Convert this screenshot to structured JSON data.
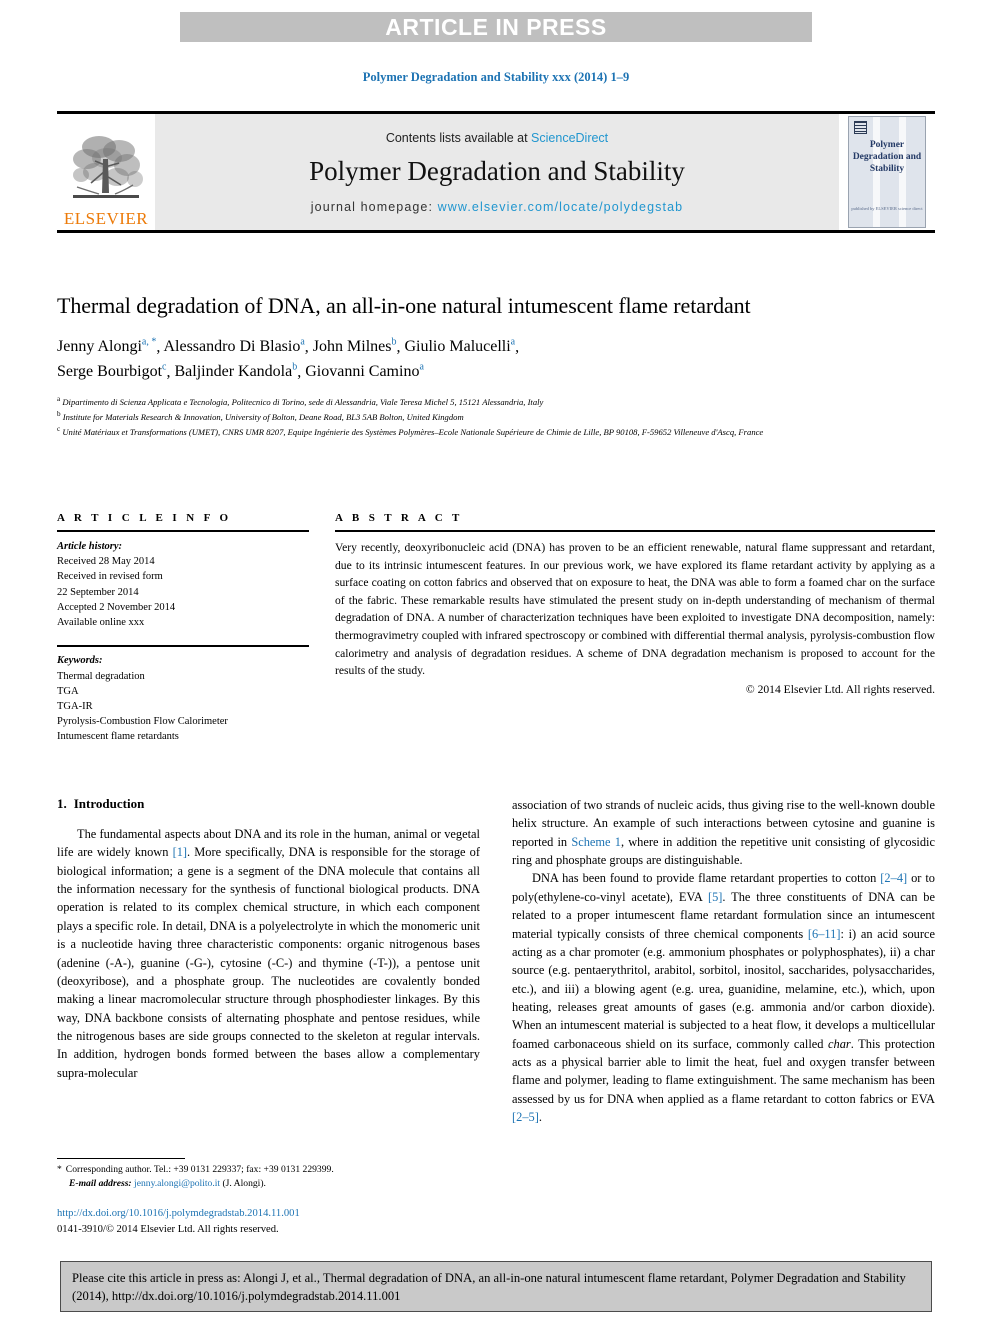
{
  "banner": {
    "text": "ARTICLE IN PRESS"
  },
  "running_head": "Polymer Degradation and Stability xxx (2014) 1–9",
  "masthead": {
    "publisher": "ELSEVIER",
    "contents_prefix": "Contents lists available at ",
    "contents_link": "ScienceDirect",
    "journal": "Polymer Degradation and Stability",
    "homepage_prefix": "journal homepage: ",
    "homepage_link": "www.elsevier.com/locate/polydegstab",
    "cover_title": "Polymer Degradation and Stability",
    "cover_footer": "published by\nELSEVIER\nscience direct"
  },
  "article": {
    "title": "Thermal degradation of DNA, an all-in-one natural intumescent flame retardant",
    "authors_line1": "Jenny Alongi",
    "authors": [
      {
        "name": "Jenny Alongi",
        "sup": "a, *"
      },
      {
        "name": "Alessandro Di Blasio",
        "sup": "a"
      },
      {
        "name": "John Milnes",
        "sup": "b"
      },
      {
        "name": "Giulio Malucelli",
        "sup": "a"
      },
      {
        "name": "Serge Bourbigot",
        "sup": "c"
      },
      {
        "name": "Baljinder Kandola",
        "sup": "b"
      },
      {
        "name": "Giovanni Camino",
        "sup": "a"
      }
    ],
    "affiliations": [
      {
        "mark": "a",
        "text": "Dipartimento di Scienza Applicata e Tecnologia, Politecnico di Torino, sede di Alessandria, Viale Teresa Michel 5, 15121 Alessandria, Italy"
      },
      {
        "mark": "b",
        "text": "Institute for Materials Research & Innovation, University of Bolton, Deane Road, BL3 5AB Bolton, United Kingdom"
      },
      {
        "mark": "c",
        "text": "Unité Matériaux et Transformations (UMET), CNRS UMR 8207, Equipe Ingénierie des Systèmes Polymères–Ecole Nationale Supérieure de Chimie de Lille, BP 90108, F-59652 Villeneuve d'Ascq, France"
      }
    ]
  },
  "info": {
    "heading": "A R T I C L E   I N F O",
    "history_label": "Article history:",
    "history": [
      "Received 28 May 2014",
      "Received in revised form",
      "22 September 2014",
      "Accepted 2 November 2014",
      "Available online xxx"
    ],
    "keywords_label": "Keywords:",
    "keywords": [
      "Thermal degradation",
      "TGA",
      "TGA-IR",
      "Pyrolysis-Combustion Flow Calorimeter",
      "Intumescent flame retardants"
    ]
  },
  "abstract": {
    "heading": "A B S T R A C T",
    "text": "Very recently, deoxyribonucleic acid (DNA) has proven to be an efficient renewable, natural flame suppressant and retardant, due to its intrinsic intumescent features. In our previous work, we have explored its flame retardant activity by applying as a surface coating on cotton fabrics and observed that on exposure to heat, the DNA was able to form a foamed char on the surface of the fabric. These remarkable results have stimulated the present study on in-depth understanding of mechanism of thermal degradation of DNA. A number of characterization techniques have been exploited to investigate DNA decomposition, namely: thermogravimetry coupled with infrared spectroscopy or combined with differential thermal analysis, pyrolysis-combustion flow calorimetry and analysis of degradation residues. A scheme of DNA degradation mechanism is proposed to account for the results of the study.",
    "copyright": "© 2014 Elsevier Ltd. All rights reserved."
  },
  "body": {
    "section_number": "1.",
    "section_title": "Introduction",
    "left_para1_a": "The fundamental aspects about DNA and its role in the human, animal or vegetal life are widely known ",
    "left_para1_cit": "[1]",
    "left_para1_b": ". More specifically, DNA is responsible for the storage of biological information; a gene is a segment of the DNA molecule that contains all the information necessary for the synthesis of functional biological products. DNA operation is related to its complex chemical structure, in which each component plays a specific role. In detail, DNA is a polyelectrolyte in which the monomeric unit is a nucleotide having three characteristic components: organic nitrogenous bases (adenine (-A-), guanine (-G-), cytosine (-C-) and thymine (-T-)), a pentose unit (deoxyribose), and a phosphate group. The nucleotides are covalently bonded making a linear macromolecular structure through phosphodiester linkages. By this way, DNA backbone consists of alternating phosphate and pentose residues, while the nitrogenous bases are side groups connected to the skeleton at regular intervals. In addition, hydrogen bonds formed between the bases allow a complementary supra-molecular",
    "right_para1_a": "association of two strands of nucleic acids, thus giving rise to the well-known double helix structure. An example of such interactions between cytosine and guanine is reported in ",
    "right_para1_link": "Scheme 1",
    "right_para1_b": ", where in addition the repetitive unit consisting of glycosidic ring and phosphate groups are distinguishable.",
    "right_para2_a": "DNA has been found to provide flame retardant properties to cotton ",
    "right_para2_cit1": "[2–4]",
    "right_para2_b": " or to poly(ethylene-co-vinyl acetate), EVA ",
    "right_para2_cit2": "[5]",
    "right_para2_c": ". The three constituents of DNA can be related to a proper intumescent flame retardant formulation since an intumescent material typically consists of three chemical components ",
    "right_para2_cit3": "[6–11]",
    "right_para2_d": ": i) an acid source acting as a char promoter (e.g. ammonium phosphates or polyphosphates), ii) a char source (e.g. pentaerythritol, arabitol, sorbitol, inositol, saccharides, polysaccharides, etc.), and iii) a blowing agent (e.g. urea, guanidine, melamine, etc.), which, upon heating, releases great amounts of gases (e.g. ammonia and/or carbon dioxide). When an intumescent material is subjected to a heat flow, it develops a multicellular foamed carbonaceous shield on its surface, commonly called ",
    "right_para2_italic": "char",
    "right_para2_e": ". This protection acts as a physical barrier able to limit the heat, fuel and oxygen transfer between flame and polymer, leading to flame extinguishment. The same mechanism has been assessed by us for DNA when applied as a flame retardant to cotton fabrics or EVA ",
    "right_para2_cit4": "[2–5]",
    "right_para2_f": "."
  },
  "footnotes": {
    "corresponding": "Corresponding author. Tel.: +39 0131 229337; fax: +39 0131 229399.",
    "email_label": "E-mail address:",
    "email": "jenny.alongi@polito.it",
    "email_suffix": "(J. Alongi).",
    "doi": "http://dx.doi.org/10.1016/j.polymdegradstab.2014.11.001",
    "issn": "0141-3910/© 2014 Elsevier Ltd. All rights reserved."
  },
  "citation_box": {
    "text": "Please cite this article in press as: Alongi J, et al., Thermal degradation of DNA, an all-in-one natural intumescent flame retardant, Polymer Degradation and Stability (2014), http://dx.doi.org/10.1016/j.polymdegradstab.2014.11.001"
  },
  "colors": {
    "banner_bg": "#bfbfbf",
    "link_blue": "#1d73b3",
    "masthead_bg": "#e9e9e9",
    "elsevier_orange": "#ec7a08",
    "cite_bg": "#c9c9c9"
  }
}
